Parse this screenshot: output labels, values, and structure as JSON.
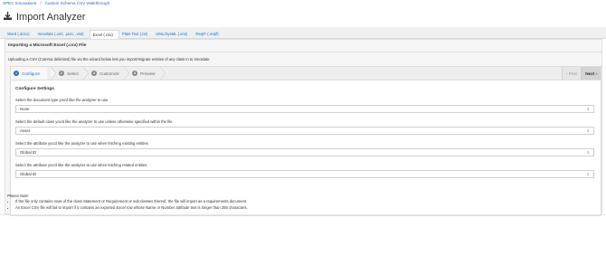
{
  "breadcrumb": {
    "items": [
      "SPEC Innovations",
      "Custom Schema CSV Walkthrough"
    ],
    "separator": "/"
  },
  "page": {
    "title": "Import Analyzer",
    "icon": "download-icon"
  },
  "tabs": [
    {
      "label": "Word (.docx)"
    },
    {
      "label": "Innoslate (.xml, .json, .xml)"
    },
    {
      "label": "Excel (.csv)"
    },
    {
      "label": "Plain Text (.txt)"
    },
    {
      "label": "UML/SysML (.xmi)"
    },
    {
      "label": "ReqIF (.reqif)"
    }
  ],
  "active_tab": 2,
  "panel": {
    "heading": "Importing a Microsoft Excel (.csv) File",
    "intro": "Uploading a CSV (Comma delimited) file via the wizard below lets you import/migrate entities of any class in to Innoslate."
  },
  "wizard": {
    "steps": [
      {
        "num": "1",
        "label": "Configure"
      },
      {
        "num": "2",
        "label": "Select"
      },
      {
        "num": "3",
        "label": "Customize"
      },
      {
        "num": "4",
        "label": "Preview"
      }
    ],
    "prev_label": "Prev",
    "next_label": "Next",
    "settings_title": "Configure Settings",
    "fields": [
      {
        "label": "Select the document type you'd like the analyzer to use",
        "value": "None"
      },
      {
        "label": "Select the default class you'd like the analyzer to use unless otherwise specified within the file",
        "value": "Asset"
      },
      {
        "label": "Select the attribute you'd like the analyzer to use when fetching existing entities",
        "value": "Global ID"
      },
      {
        "label": "Select the attribute you'd like the analyzer to use when fetching related entities",
        "value": "Global ID"
      }
    ]
  },
  "note": {
    "title": "Please Note:",
    "items": [
      "If the file only contains rows of the class Statement or Requirement or sub-classes thereof, the file will import as a requirements document.",
      "An Excel CSV file will fail to import if it contains an exported Excel row whose Name or Number attribute text is longer than 255 characters."
    ]
  },
  "colors": {
    "accent": "#2a6ebb",
    "panel_bg": "#f5f5f5",
    "tab_bar_bg": "#eef0f2"
  }
}
